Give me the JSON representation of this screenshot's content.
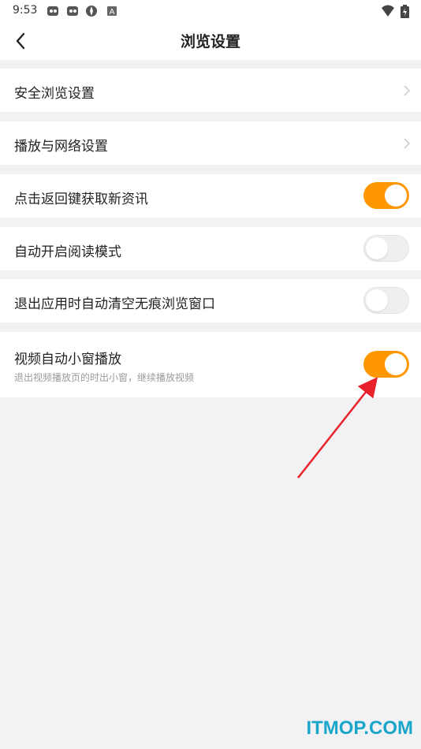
{
  "status_bar": {
    "time": "9:53",
    "icons": [
      "notification-app-icon",
      "notification-app-icon",
      "vpn-icon",
      "keyboard-a-icon"
    ],
    "right_icons": [
      "wifi-icon",
      "battery-icon"
    ]
  },
  "header": {
    "title": "浏览设置",
    "back_icon": "chevron-left-icon"
  },
  "settings": [
    {
      "label": "安全浏览设置",
      "type": "link"
    },
    {
      "label": "播放与网络设置",
      "type": "link"
    },
    {
      "label": "点击返回键获取新资讯",
      "type": "toggle",
      "state": "on"
    },
    {
      "label": "自动开启阅读模式",
      "type": "toggle",
      "state": "off"
    },
    {
      "label": "退出应用时自动清空无痕浏览窗口",
      "type": "toggle",
      "state": "off"
    },
    {
      "label": "视频自动小窗播放",
      "sublabel": "退出视频播放页的时出小窗，继续播放视频",
      "type": "toggle",
      "state": "on"
    }
  ],
  "annotation": {
    "arrow_color": "#e8212a"
  },
  "watermark": "ITMOP.COM",
  "colors": {
    "accent": "#ff9800",
    "background": "#f2f2f4"
  }
}
